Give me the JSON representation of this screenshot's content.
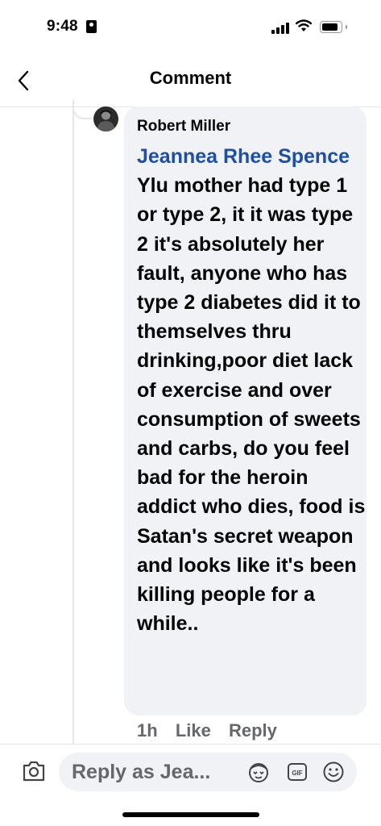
{
  "status_bar": {
    "time": "9:48"
  },
  "header": {
    "title": "Comment"
  },
  "comment": {
    "author": "Robert Miller",
    "mention": "Jeannea Rhee Spence",
    "text": " Ylu mother had type 1 or type 2, it it was type 2 it's absolutely her fault, anyone who has type 2 diabetes did it to themselves thru drinking,poor diet lack of exercise and over consumption of sweets and carbs, do you feel bad for the heroin addict who dies, food is Satan's secret weapon and looks like it's been killing people for a while..",
    "time_ago": "1h",
    "like_label": "Like",
    "reply_label": "Reply"
  },
  "reply_bar": {
    "placeholder": "Reply as Jea..."
  },
  "colors": {
    "mention": "#1b4fa8",
    "bubble": "#f0f2f5",
    "muted": "#65676b"
  },
  "icons": [
    "back-arrow-icon",
    "camera-icon",
    "avatar-sticker-icon",
    "gif-icon",
    "emoji-icon"
  ]
}
